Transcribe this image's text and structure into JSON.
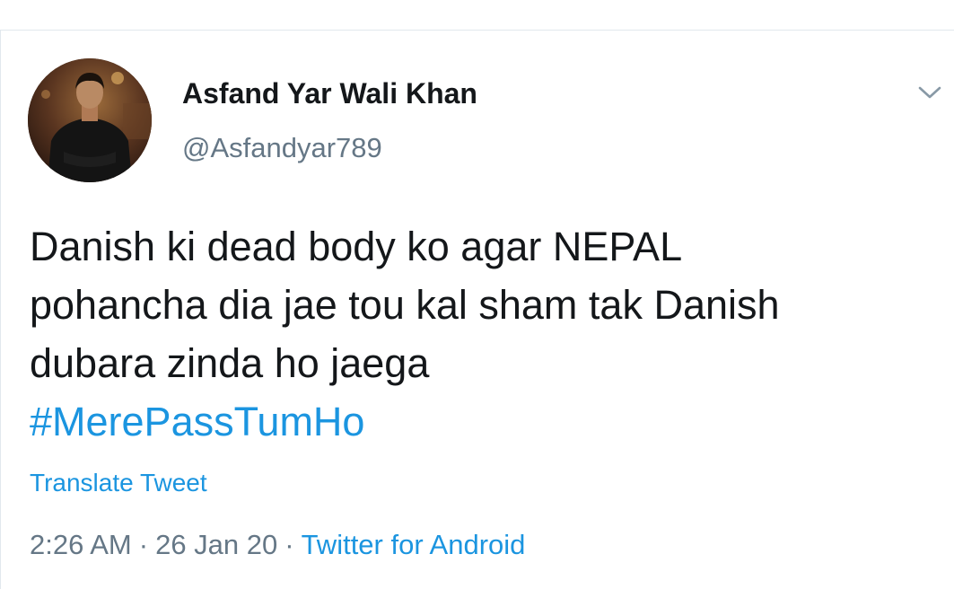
{
  "tweet": {
    "author": {
      "display_name": "Asfand Yar Wali Khan",
      "handle": "@Asfandyar789"
    },
    "text_lines": [
      "Danish ki dead body ko agar NEPAL",
      "pohancha dia jae tou kal sham tak Danish",
      "dubara zinda ho jaega"
    ],
    "hashtag": "#MerePassTumHo",
    "translate_label": "Translate Tweet",
    "meta": {
      "time": "2:26 AM",
      "separator": "·",
      "date": "26 Jan 20",
      "source": "Twitter for Android"
    }
  },
  "icons": {
    "menu_caret": "chevron-down-icon",
    "avatar": "profile-photo"
  },
  "colors": {
    "link": "#1b95e0",
    "text_primary": "#14171a",
    "text_secondary": "#657786",
    "divider": "#e1e8ed"
  }
}
